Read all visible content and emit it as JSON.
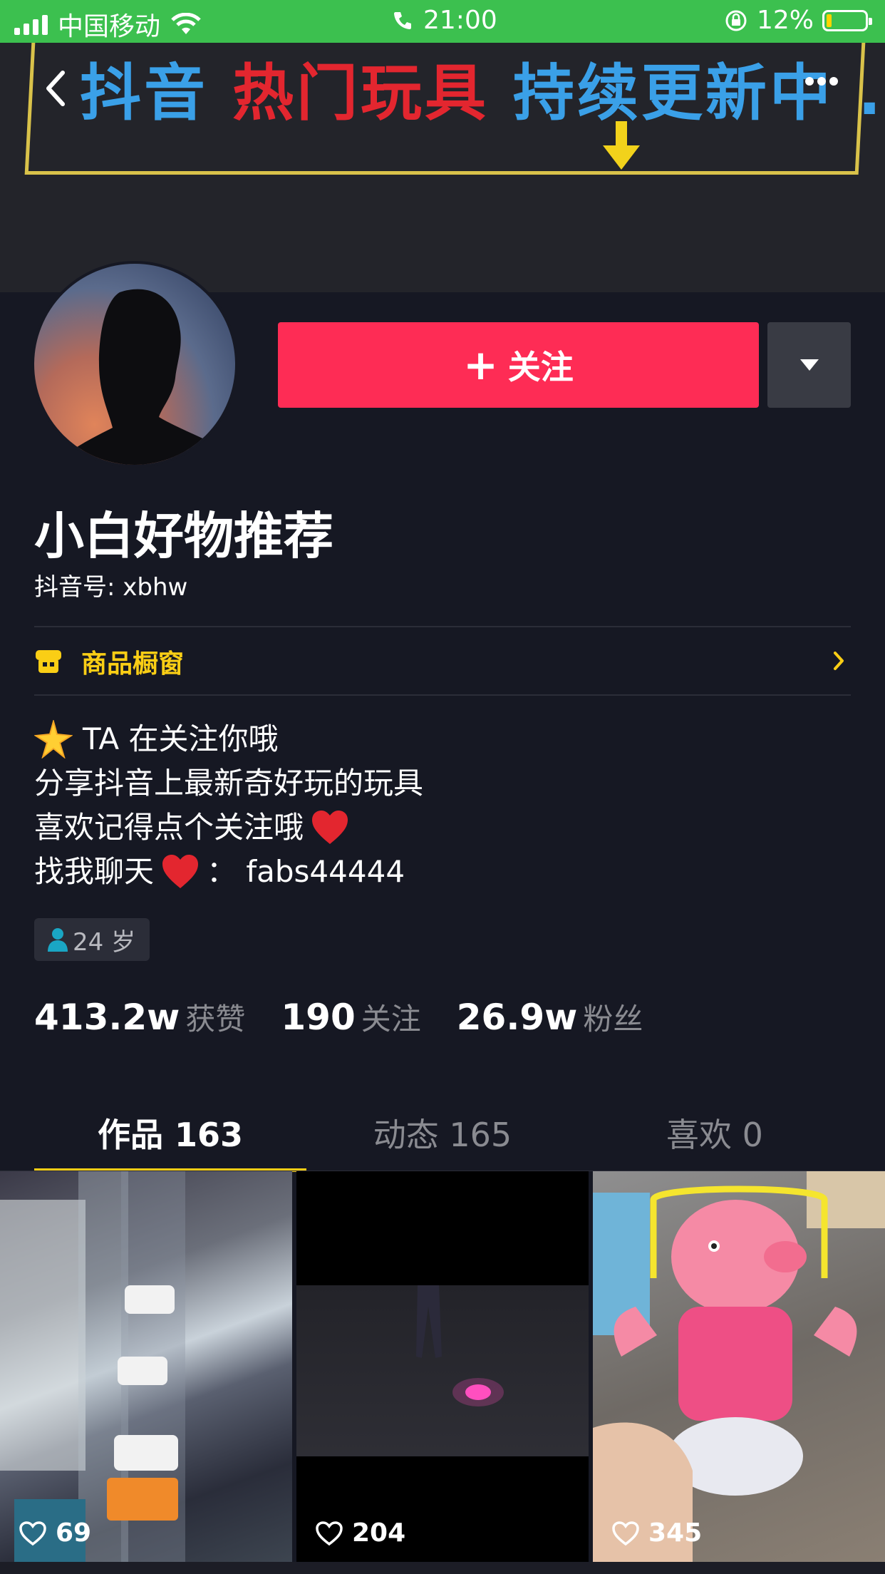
{
  "status_bar": {
    "carrier": "中国移动",
    "time": "21:00",
    "battery": "12%"
  },
  "banner": {
    "text_part1": "抖音",
    "text_hot": "热门玩具",
    "text_part2": "持续更新中",
    "ellipsis": "..."
  },
  "profile": {
    "follow_label": "关注",
    "nickname": "小白好物推荐",
    "douyin_id": "抖音号: xbhw",
    "shop_label": "商品橱窗",
    "bio": {
      "line1": "TA 在关注你哦",
      "line2": "分享抖音上最新奇好玩的玩具",
      "line3": "喜欢记得点个关注哦",
      "line4_prefix": "找我聊天",
      "line4_suffix": "：  fabs44444"
    },
    "age": "24 岁"
  },
  "stats": [
    {
      "value": "413.2w",
      "label": "获赞"
    },
    {
      "value": "190",
      "label": "关注"
    },
    {
      "value": "26.9w",
      "label": "粉丝"
    }
  ],
  "tabs": [
    {
      "label": "作品 163",
      "active": true
    },
    {
      "label": "动态 165",
      "active": false
    },
    {
      "label": "喜欢 0",
      "active": false
    }
  ],
  "videos": [
    {
      "likes": "69"
    },
    {
      "likes": "204"
    },
    {
      "likes": "345"
    }
  ],
  "colors": {
    "accent_red": "#fe2c55",
    "accent_yellow": "#face15",
    "background": "#161823",
    "status_bar": "#3cc04f"
  }
}
